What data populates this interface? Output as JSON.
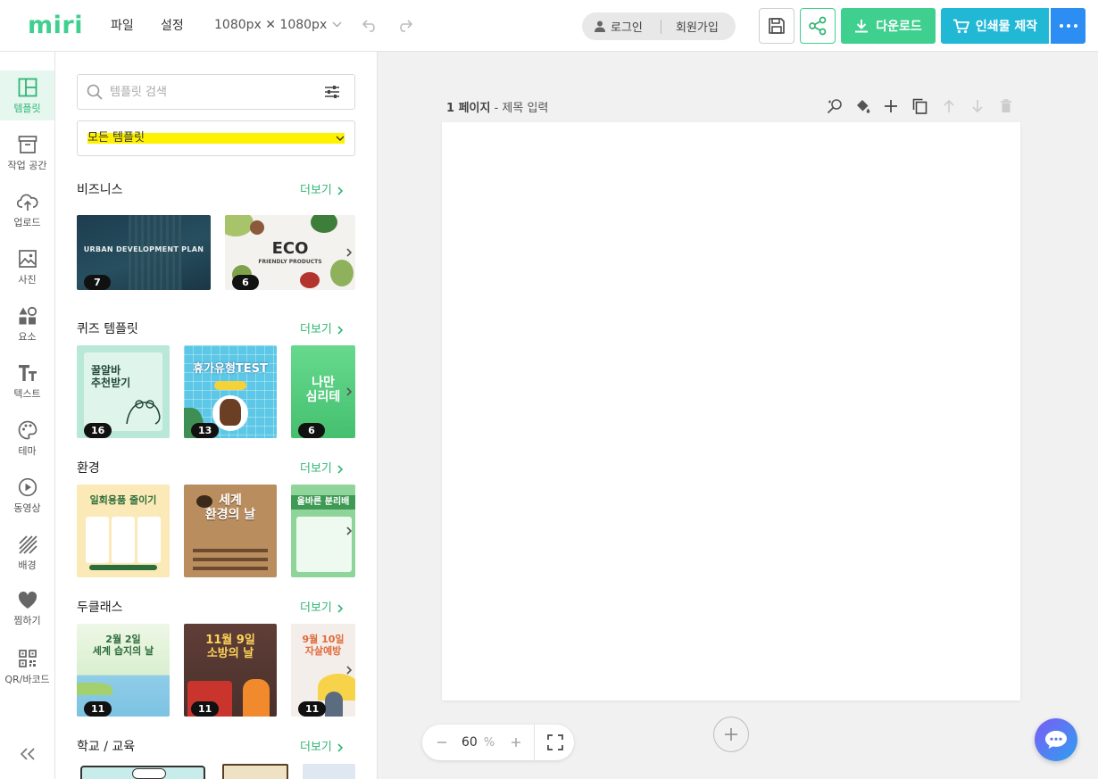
{
  "header": {
    "logo": "miri",
    "menu": {
      "file": "파일",
      "settings": "설정"
    },
    "size": "1080px ✕ 1080px",
    "auth": {
      "login": "로그인",
      "signup": "회원가입"
    },
    "download_label": "다운로드",
    "print_label": "인쇄물 제작"
  },
  "sidebar": {
    "items": [
      {
        "label": "템플릿",
        "icon": "template-icon",
        "active": true
      },
      {
        "label": "작업 공간",
        "icon": "archive-icon"
      },
      {
        "label": "업로드",
        "icon": "cloud-upload-icon"
      },
      {
        "label": "사진",
        "icon": "photo-icon"
      },
      {
        "label": "요소",
        "icon": "shapes-icon"
      },
      {
        "label": "텍스트",
        "icon": "text-icon"
      },
      {
        "label": "테마",
        "icon": "palette-icon"
      },
      {
        "label": "동영상",
        "icon": "play-icon"
      },
      {
        "label": "배경",
        "icon": "background-icon"
      },
      {
        "label": "찜하기",
        "icon": "heart-icon"
      },
      {
        "label": "QR/바코드",
        "icon": "qr-icon"
      }
    ]
  },
  "panel": {
    "search_placeholder": "템플릿 검색",
    "category": "모든 템플릿",
    "more_label": "더보기",
    "sections": [
      {
        "title": "비즈니스",
        "thumbs": [
          {
            "badge": "7",
            "text": "URBAN DEVELOPMENT PLAN"
          },
          {
            "badge": "6",
            "text": "ECO",
            "sub": "FRIENDLY PRODUCTS"
          }
        ]
      },
      {
        "title": "퀴즈 템플릿",
        "thumbs": [
          {
            "badge": "16",
            "text": "꿀알바\n추천받기"
          },
          {
            "badge": "13",
            "text": "휴가유형TEST"
          },
          {
            "badge": "6",
            "text": "나만\n심리테"
          }
        ]
      },
      {
        "title": "환경",
        "thumbs": [
          {
            "text": "일회용품 줄이기"
          },
          {
            "text": "세계\n환경의 날"
          },
          {
            "text": "올바른 분리배"
          }
        ]
      },
      {
        "title": "두클래스",
        "thumbs": [
          {
            "badge": "11",
            "text": "2월 2일\n세계 습지의 날"
          },
          {
            "badge": "11",
            "text": "11월 9일\n소방의 날"
          },
          {
            "badge": "11",
            "text": "9월 10일\n자살예방"
          }
        ]
      },
      {
        "title": "학교 / 교육",
        "thumbs": []
      }
    ]
  },
  "workspace": {
    "page_number": "1 페이지",
    "page_title_placeholder": "- 제목 입력",
    "zoom": "60",
    "zoom_unit": "%"
  },
  "colors": {
    "brand": "#3fcf8e",
    "print": "#21b8d6",
    "more": "#2c8df2",
    "highlight": "#fff200"
  }
}
